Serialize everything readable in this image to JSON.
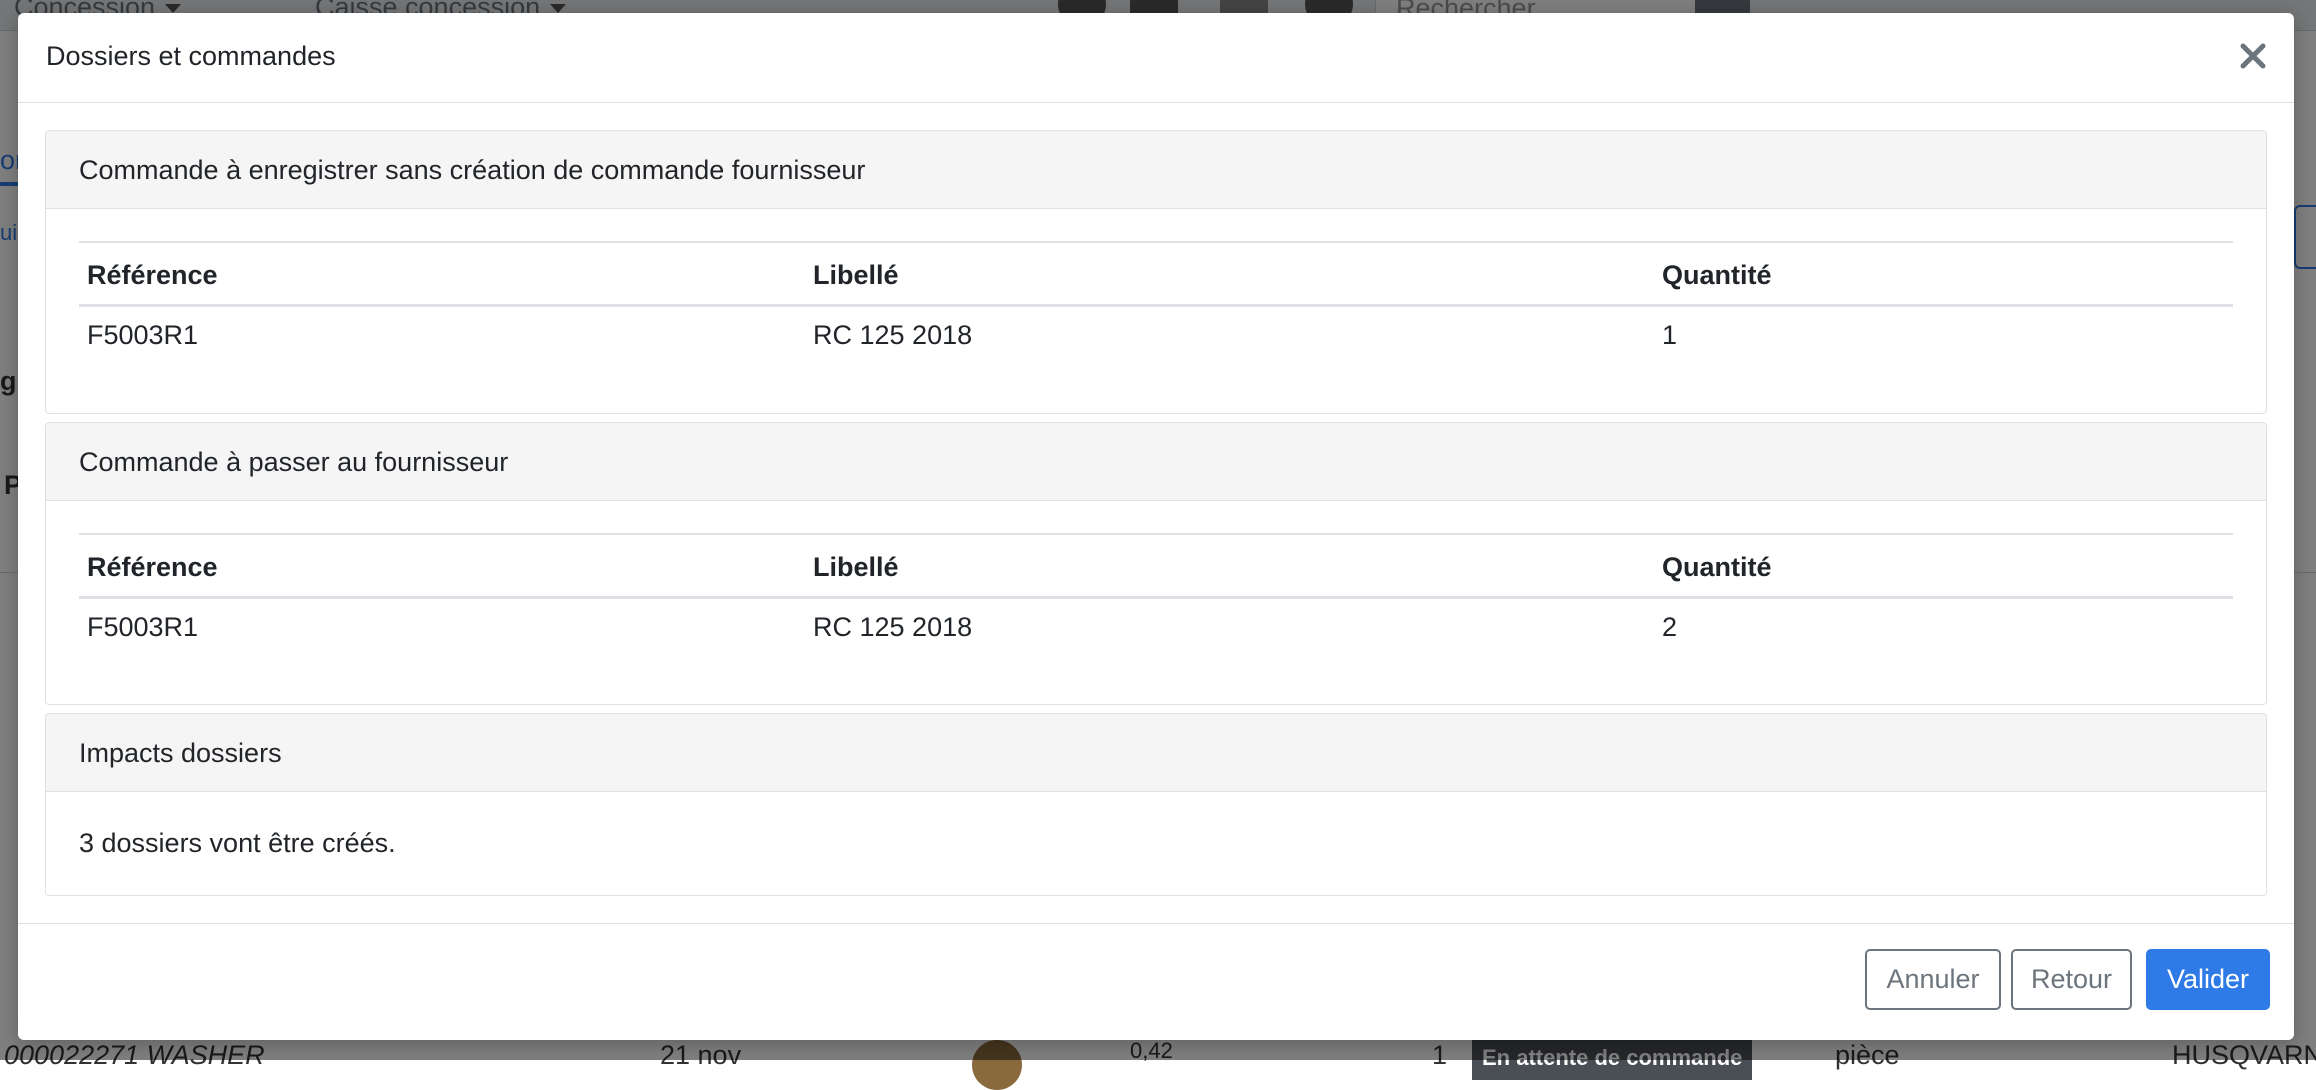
{
  "background": {
    "topbar": {
      "left_select": "Concession",
      "middle_select": "Caisse concession",
      "search_placeholder": "Rechercher"
    },
    "fragments": {
      "tab_fragment": "om",
      "sub_fragment": "ui",
      "p_fragment": "P",
      "g_fragment": "gu",
      "bottom_row_ref": "000022271 WASHER",
      "bottom_row_date": "21 nov",
      "bottom_row_price": "0,42",
      "bottom_row_qty": "1",
      "bottom_row_status": "En attente de commande",
      "bottom_row_unit": "pièce",
      "bottom_row_brand": "HUSQVARN"
    }
  },
  "modal": {
    "title": "Dossiers et commandes",
    "sections": [
      {
        "header": "Commande à enregistrer sans création de commande fournisseur",
        "columns": [
          "Référence",
          "Libellé",
          "Quantité"
        ],
        "rows": [
          [
            "F5003R1",
            "RC 125 2018",
            "1"
          ]
        ]
      },
      {
        "header": "Commande à passer au fournisseur",
        "columns": [
          "Référence",
          "Libellé",
          "Quantité"
        ],
        "rows": [
          [
            "F5003R1",
            "RC 125 2018",
            "2"
          ]
        ]
      },
      {
        "header": "Impacts dossiers",
        "text": "3 dossiers vont être créés."
      }
    ],
    "footer": {
      "cancel_label": "Annuler",
      "back_label": "Retour",
      "validate_label": "Valider"
    }
  },
  "colors": {
    "primary": "#2e7ae6",
    "secondary": "#6c757d",
    "card_header_bg": "#f5f5f5",
    "border": "#dee2e6"
  },
  "icons": {
    "close": "close-icon",
    "search": "search-icon",
    "caret": "chevron-down-icon"
  }
}
